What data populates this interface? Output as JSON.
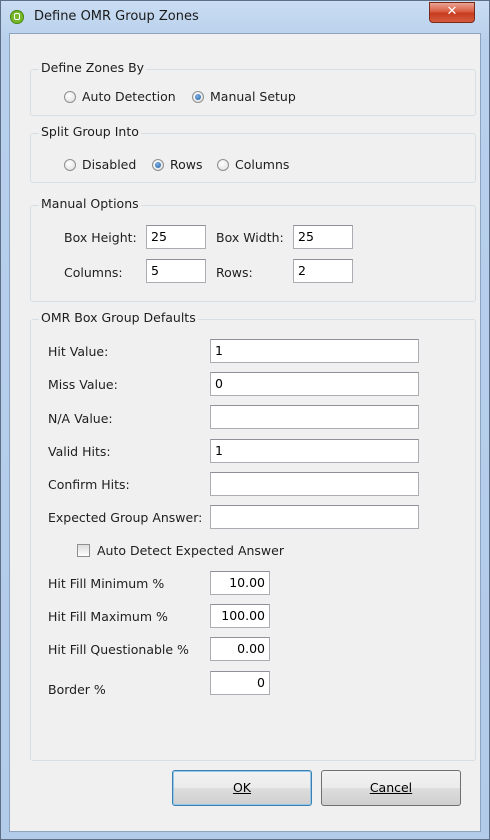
{
  "window": {
    "title": "Define OMR Group Zones",
    "close_glyph": "✕"
  },
  "define_zones": {
    "title": "Define Zones By",
    "options": [
      {
        "label": "Auto Detection",
        "checked": false
      },
      {
        "label": "Manual Setup",
        "checked": true
      }
    ]
  },
  "split_group": {
    "title": "Split Group Into",
    "options": [
      {
        "label": "Disabled",
        "checked": false
      },
      {
        "label": "Rows",
        "checked": true
      },
      {
        "label": "Columns",
        "checked": false
      }
    ]
  },
  "manual_options": {
    "title": "Manual Options",
    "box_height_label": "Box Height:",
    "box_height_value": "25",
    "box_width_label": "Box Width:",
    "box_width_value": "25",
    "columns_label": "Columns:",
    "columns_value": "5",
    "rows_label": "Rows:",
    "rows_value": "2"
  },
  "defaults": {
    "title": "OMR Box Group Defaults",
    "hit_value_label": "Hit Value:",
    "hit_value": "1",
    "miss_value_label": "Miss Value:",
    "miss_value": "0",
    "na_value_label": "N/A Value:",
    "na_value": "",
    "valid_hits_label": "Valid Hits:",
    "valid_hits": "1",
    "confirm_hits_label": "Confirm Hits:",
    "confirm_hits": "",
    "expected_answer_label": "Expected Group Answer:",
    "expected_answer": "",
    "auto_detect_label": "Auto Detect Expected Answer",
    "auto_detect_checked": false,
    "hit_fill_min_label": "Hit Fill Minimum %",
    "hit_fill_min": "10.00",
    "hit_fill_max_label": "Hit Fill Maximum %",
    "hit_fill_max": "100.00",
    "hit_fill_q_label": "Hit Fill Questionable %",
    "hit_fill_q": "0.00",
    "border_label": "Border %",
    "border": "0"
  },
  "buttons": {
    "ok_label": "OK",
    "cancel_label": "Cancel"
  }
}
